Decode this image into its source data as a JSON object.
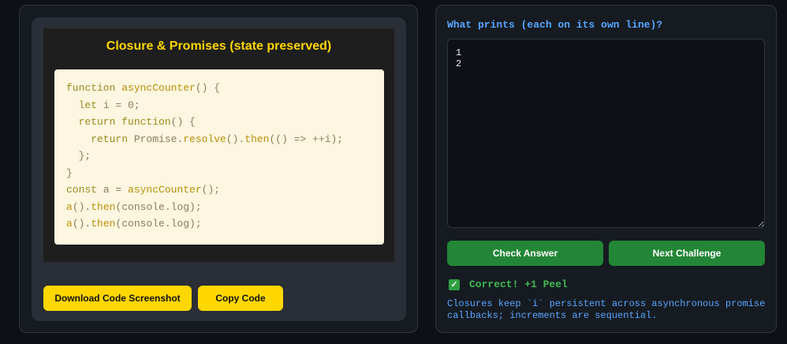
{
  "challenge": {
    "title": "Closure & Promises (state preserved)",
    "code_lines": [
      [
        {
          "t": "function ",
          "c": "kw"
        },
        {
          "t": "asyncCounter",
          "c": "fn"
        },
        {
          "t": "() {",
          "c": "pn"
        }
      ],
      [
        {
          "t": "  let ",
          "c": "kw"
        },
        {
          "t": "i = 0;",
          "c": "pn"
        }
      ],
      [
        {
          "t": "  return ",
          "c": "kw"
        },
        {
          "t": "function",
          "c": "kw"
        },
        {
          "t": "() {",
          "c": "pn"
        }
      ],
      [
        {
          "t": "    return ",
          "c": "kw"
        },
        {
          "t": "Promise.",
          "c": "pn"
        },
        {
          "t": "resolve",
          "c": "fn"
        },
        {
          "t": "().",
          "c": "pn"
        },
        {
          "t": "then",
          "c": "fn"
        },
        {
          "t": "(() => ++i);",
          "c": "pn"
        }
      ],
      [
        {
          "t": "  };",
          "c": "pn"
        }
      ],
      [
        {
          "t": "}",
          "c": "pn"
        }
      ],
      [
        {
          "t": "const ",
          "c": "kw"
        },
        {
          "t": "a = ",
          "c": "pn"
        },
        {
          "t": "asyncCounter",
          "c": "fn"
        },
        {
          "t": "();",
          "c": "pn"
        }
      ],
      [
        {
          "t": "a",
          "c": "fn"
        },
        {
          "t": "().",
          "c": "pn"
        },
        {
          "t": "then",
          "c": "fn"
        },
        {
          "t": "(console.log);",
          "c": "pn"
        }
      ],
      [
        {
          "t": "a",
          "c": "fn"
        },
        {
          "t": "().",
          "c": "pn"
        },
        {
          "t": "then",
          "c": "fn"
        },
        {
          "t": "(console.log);",
          "c": "pn"
        }
      ]
    ]
  },
  "actions": {
    "download_label": "Download Code Screenshot",
    "copy_label": "Copy Code"
  },
  "quiz": {
    "question": "What prints (each on its own line)?",
    "answer_value": "1\n2",
    "check_label": "Check Answer",
    "next_label": "Next Challenge",
    "result_icon": "check-icon",
    "result_text": "Correct! +1 Peel",
    "explanation": "Closures keep `i` persistent across asynchronous promise callbacks; increments are sequential."
  },
  "colors": {
    "accent_yellow": "#ffd700",
    "accent_green": "#238636",
    "accent_blue": "#58a6ff",
    "success_text": "#3fb950"
  }
}
